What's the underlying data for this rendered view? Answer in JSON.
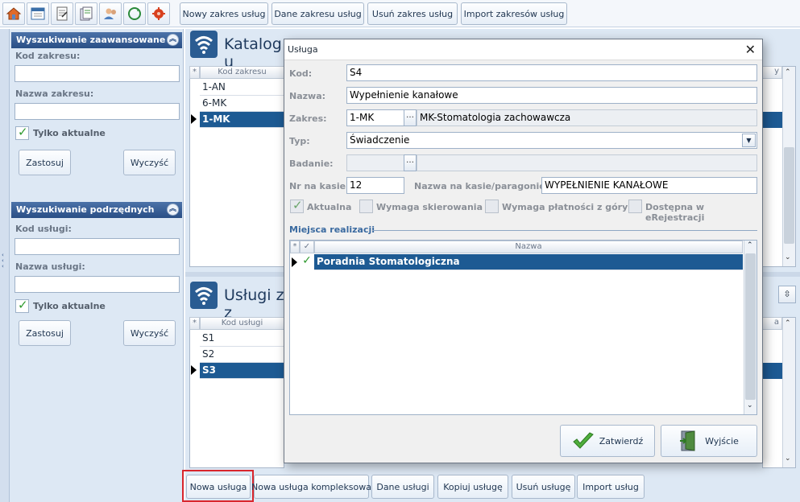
{
  "toolbar": {
    "icons": [
      "home-icon",
      "calendar-icon",
      "documents-icon",
      "files-icon",
      "users-icon",
      "refresh-icon",
      "settings-icon"
    ],
    "buttons": [
      "Nowy zakres usług",
      "Dane zakresu usług",
      "Usuń zakres usług",
      "Import zakresów usług"
    ]
  },
  "sidebar": {
    "advanced": {
      "title": "Wyszukiwanie zaawansowane",
      "code_label": "Kod zakresu:",
      "code_value": "",
      "name_label": "Nazwa zakresu:",
      "name_value": "",
      "only_current": "Tylko aktualne",
      "apply": "Zastosuj",
      "clear": "Wyczyść"
    },
    "sub": {
      "title": "Wyszukiwanie podrzędnych",
      "code_label": "Kod usługi:",
      "code_value": "",
      "name_label": "Nazwa usługi:",
      "name_value": "",
      "only_current": "Tylko aktualne",
      "apply": "Zastosuj",
      "clear": "Wyczyść"
    }
  },
  "catalog": {
    "title": "Katalog u",
    "column": "Kod zakresu",
    "rows": [
      "1-AN",
      "6-MK",
      "1-MK"
    ],
    "selected_index": 2
  },
  "services": {
    "title": "Usługi z z",
    "column": "Kod usługi",
    "rows": [
      "S1",
      "S2",
      "S3"
    ],
    "selected_index": 2
  },
  "bottom_buttons": [
    "Nowa usługa",
    "Nowa usługa kompleksowa",
    "Dane usługi",
    "Kopiuj usługę",
    "Usuń usługę",
    "Import usług"
  ],
  "dialog": {
    "title": "Usługa",
    "fields": {
      "kod_label": "Kod:",
      "kod_value": "S4",
      "nazwa_label": "Nazwa:",
      "nazwa_value": "Wypełnienie kanałowe",
      "zakres_label": "Zakres:",
      "zakres_code": "1-MK",
      "zakres_name": "MK-Stomatologia zachowawcza",
      "typ_label": "Typ:",
      "typ_value": "Świadczenie",
      "badanie_label": "Badanie:",
      "badanie_value": "",
      "nr_label": "Nr na kasie:",
      "nr_value": "12",
      "kasa_label": "Nazwa na kasie/paragonie:",
      "kasa_value": "WYPEŁNIENIE KANAŁOWE"
    },
    "checkboxes": {
      "aktualna": "Aktualna",
      "skierowanie": "Wymaga skierowania",
      "platnosc": "Wymaga płatności z góry",
      "erejestracja": "Dostępna w eRejestracji"
    },
    "places": {
      "title": "Miejsca realizacji",
      "column": "Nazwa",
      "rows": [
        "Poradnia Stomatologiczna"
      ]
    },
    "confirm": "Zatwierdź",
    "exit": "Wyjście"
  }
}
